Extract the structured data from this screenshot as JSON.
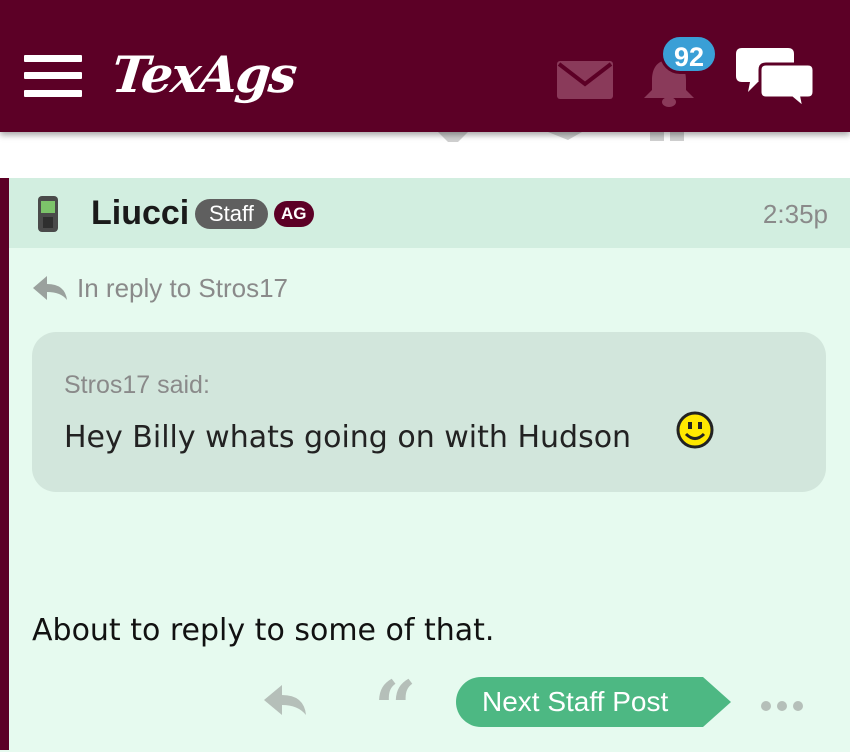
{
  "app": {
    "logo": "TexAgs",
    "notifications_count": "92",
    "brand_color": "#5c0026"
  },
  "icons": [
    "menu-icon",
    "mail-icon",
    "bell-icon",
    "chat-bubbles-icon",
    "phone-icon",
    "reply-arrow-icon",
    "smiley-icon",
    "quote-icon",
    "more-icon"
  ],
  "post": {
    "username": "Liucci",
    "staff_badge": "Staff",
    "ag_badge": "AG",
    "time": "2:35p",
    "reply_to": "In reply to Stros17",
    "quote": {
      "author": "Stros17 said:",
      "text": "Hey Billy whats going on with Hudson"
    },
    "body": "About to reply to some of that.",
    "actions": {
      "next_staff": "Next Staff Post"
    }
  }
}
